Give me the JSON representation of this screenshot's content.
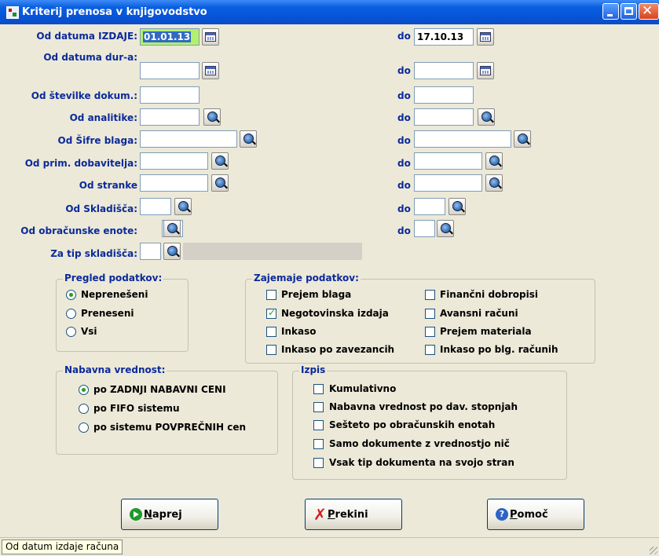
{
  "window": {
    "title": "Kriterij prenosa v knjigovodstvo"
  },
  "filters": {
    "to_label": "do",
    "date_issue": {
      "label": "Od datuma IZDAJE:",
      "from": "01.01.13",
      "to": "17.10.13"
    },
    "date_dur": {
      "label": "Od datuma dur-a:",
      "from": "",
      "to": ""
    },
    "doc_number": {
      "label": "Od številke dokum.:",
      "from": "",
      "to": ""
    },
    "analytics": {
      "label": "Od analitike:",
      "from": "",
      "to": ""
    },
    "goods_code": {
      "label": "Od Šifre blaga:",
      "from": "",
      "to": ""
    },
    "supplier": {
      "label": "Od prim. dobavitelja:",
      "from": "",
      "to": ""
    },
    "customer": {
      "label": "Od stranke",
      "from": "",
      "to": ""
    },
    "warehouse": {
      "label": "Od Skladišča:",
      "from": "",
      "to": ""
    },
    "accounting_unit": {
      "label": "Od obračunske enote:",
      "from": "",
      "to": ""
    },
    "warehouse_type": {
      "label": "Za tip skladišča:",
      "value": "",
      "description": ""
    }
  },
  "review": {
    "title": "Pregled podatkov:",
    "options": [
      {
        "label": "Neprenešeni",
        "selected": true
      },
      {
        "label": "Preneseni",
        "selected": false
      },
      {
        "label": "Vsi",
        "selected": false
      }
    ]
  },
  "capture": {
    "title": "Zajemaje podatkov:",
    "options": [
      {
        "label": "Prejem blaga",
        "checked": false
      },
      {
        "label": "Negotovinska izdaja",
        "checked": true
      },
      {
        "label": "Inkaso",
        "checked": false
      },
      {
        "label": "Inkaso po zavezancih",
        "checked": false
      },
      {
        "label": "Finančni dobropisi",
        "checked": false
      },
      {
        "label": "Avansni računi",
        "checked": false
      },
      {
        "label": "Prejem materiala",
        "checked": false
      },
      {
        "label": "Inkaso po blg. računih",
        "checked": false
      }
    ]
  },
  "purchase_value": {
    "title": "Nabavna vrednost:",
    "options": [
      {
        "label": "po ZADNJI NABAVNI CENI",
        "selected": true
      },
      {
        "label": "po FIFO sistemu",
        "selected": false
      },
      {
        "label": "po sistemu POVPREČNIH cen",
        "selected": false
      }
    ]
  },
  "print": {
    "title": "Izpis",
    "options": [
      {
        "label": "Kumulativno",
        "checked": false
      },
      {
        "label": "Nabavna vrednost po dav. stopnjah",
        "checked": false
      },
      {
        "label": "Sešteto po obračunskih enotah",
        "checked": false
      },
      {
        "label": "Samo dokumente z vrednostjo nič",
        "checked": false
      },
      {
        "label": "Vsak tip dokumenta na svojo stran",
        "checked": false
      }
    ]
  },
  "buttons": {
    "next": {
      "mnemonic": "N",
      "rest": "aprej"
    },
    "cancel": {
      "mnemonic": "P",
      "rest": "rekini"
    },
    "help": {
      "mnemonic": "P",
      "rest": "omoč"
    }
  },
  "status": {
    "text": "Od datum izdaje računa"
  }
}
